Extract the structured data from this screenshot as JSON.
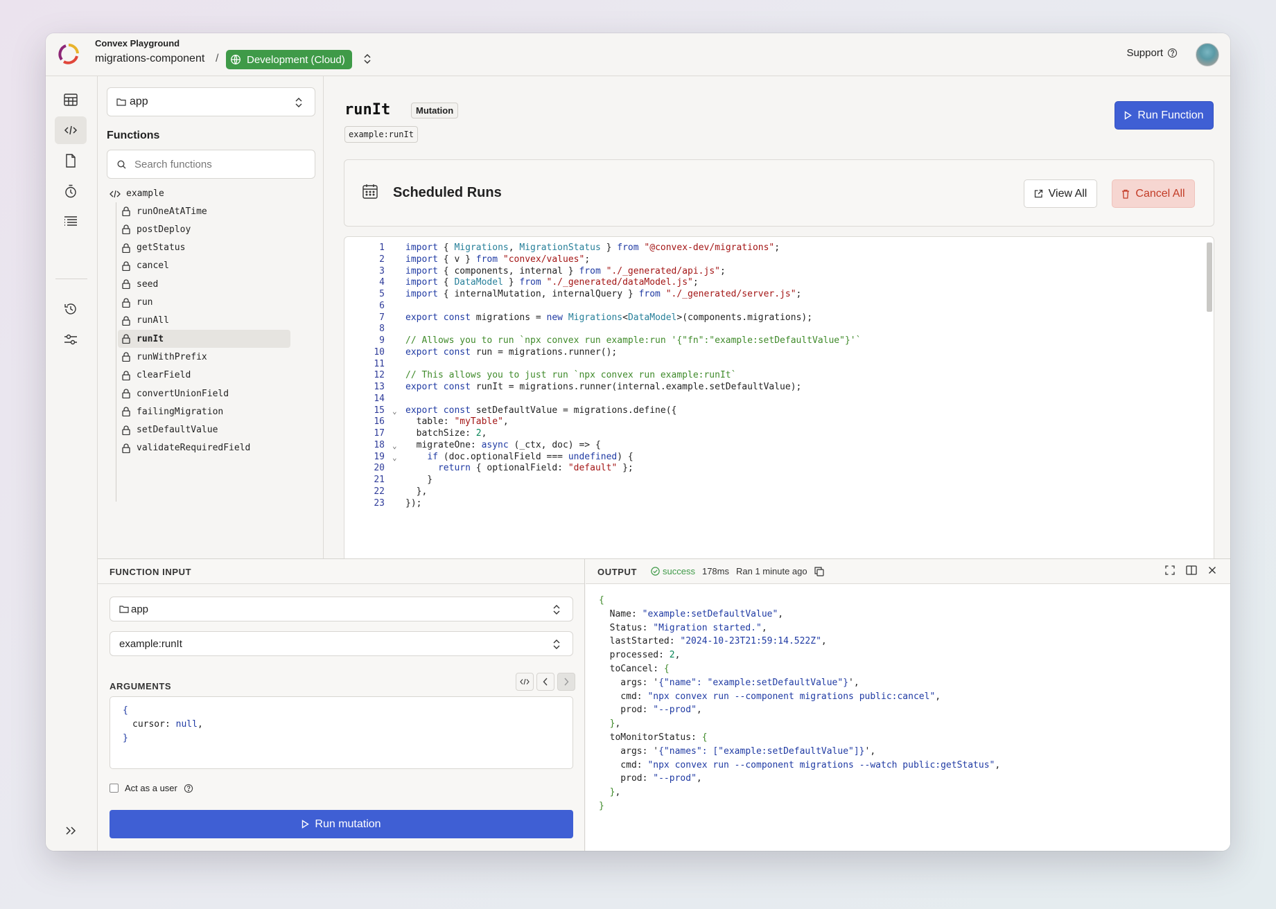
{
  "header": {
    "app_title": "Convex Playground",
    "project": "migrations-component",
    "separator": "/",
    "environment": "Development (Cloud)",
    "support": "Support",
    "env_color": "#3f9a48"
  },
  "rail": {
    "items": [
      {
        "name": "data-icon"
      },
      {
        "name": "functions-icon"
      },
      {
        "name": "files-icon"
      },
      {
        "name": "schedules-icon"
      },
      {
        "name": "logs-icon"
      },
      {
        "name": "history-icon"
      },
      {
        "name": "settings-icon"
      }
    ]
  },
  "functions_panel": {
    "component": "app",
    "heading": "Functions",
    "search_placeholder": "Search functions",
    "module": "example",
    "items": [
      "runOneAtATime",
      "postDeploy",
      "getStatus",
      "cancel",
      "seed",
      "run",
      "runAll",
      "runIt",
      "runWithPrefix",
      "clearField",
      "convertUnionField",
      "failingMigration",
      "setDefaultValue",
      "validateRequiredField"
    ],
    "active": "runIt"
  },
  "main": {
    "function_name": "runIt",
    "function_type": "Mutation",
    "function_path": "example:runIt",
    "run_button": "Run Function",
    "scheduled_title": "Scheduled Runs",
    "view_all": "View All",
    "cancel_all": "Cancel All",
    "accent": "#3f5fd4"
  },
  "code": [
    "import { Migrations, MigrationStatus } from \"@convex-dev/migrations\";",
    "import { v } from \"convex/values\";",
    "import { components, internal } from \"./_generated/api.js\";",
    "import { DataModel } from \"./_generated/dataModel.js\";",
    "import { internalMutation, internalQuery } from \"./_generated/server.js\";",
    "",
    "export const migrations = new Migrations<DataModel>(components.migrations);",
    "",
    "// Allows you to run `npx convex run example:run '{\"fn\":\"example:setDefaultValue\"}'`",
    "export const run = migrations.runner();",
    "",
    "// This allows you to just run `npx convex run example:runIt`",
    "export const runIt = migrations.runner(internal.example.setDefaultValue);",
    "",
    "export const setDefaultValue = migrations.define({",
    "  table: \"myTable\",",
    "  batchSize: 2,",
    "  migrateOne: async (_ctx, doc) => {",
    "    if (doc.optionalField === undefined) {",
    "      return { optionalField: \"default\" };",
    "    }",
    "  },",
    "});"
  ],
  "function_input": {
    "label": "FUNCTION INPUT",
    "component": "app",
    "function": "example:runIt",
    "arguments_label": "ARGUMENTS",
    "args_open": "{",
    "args_key": "cursor",
    "args_value": "null",
    "args_close": "}",
    "act_as_user": "Act as a user",
    "run_button": "Run mutation"
  },
  "output": {
    "label": "OUTPUT",
    "status": "success",
    "duration": "178ms",
    "ran": "Ran 1 minute ago",
    "name": "example:setDefaultValue",
    "status_text": "Migration started.",
    "last_started": "2024-10-23T21:59:14.522Z",
    "processed": "2",
    "to_cancel_args": "{\"name\": \"example:setDefaultValue\"}",
    "to_cancel_cmd": "npx convex run --component migrations public:cancel",
    "to_cancel_prod": "--prod",
    "to_monitor_args": "{\"names\": [\"example:setDefaultValue\"]}",
    "to_monitor_cmd": "npx convex run --component migrations --watch public:getStatus",
    "to_monitor_prod": "--prod"
  }
}
